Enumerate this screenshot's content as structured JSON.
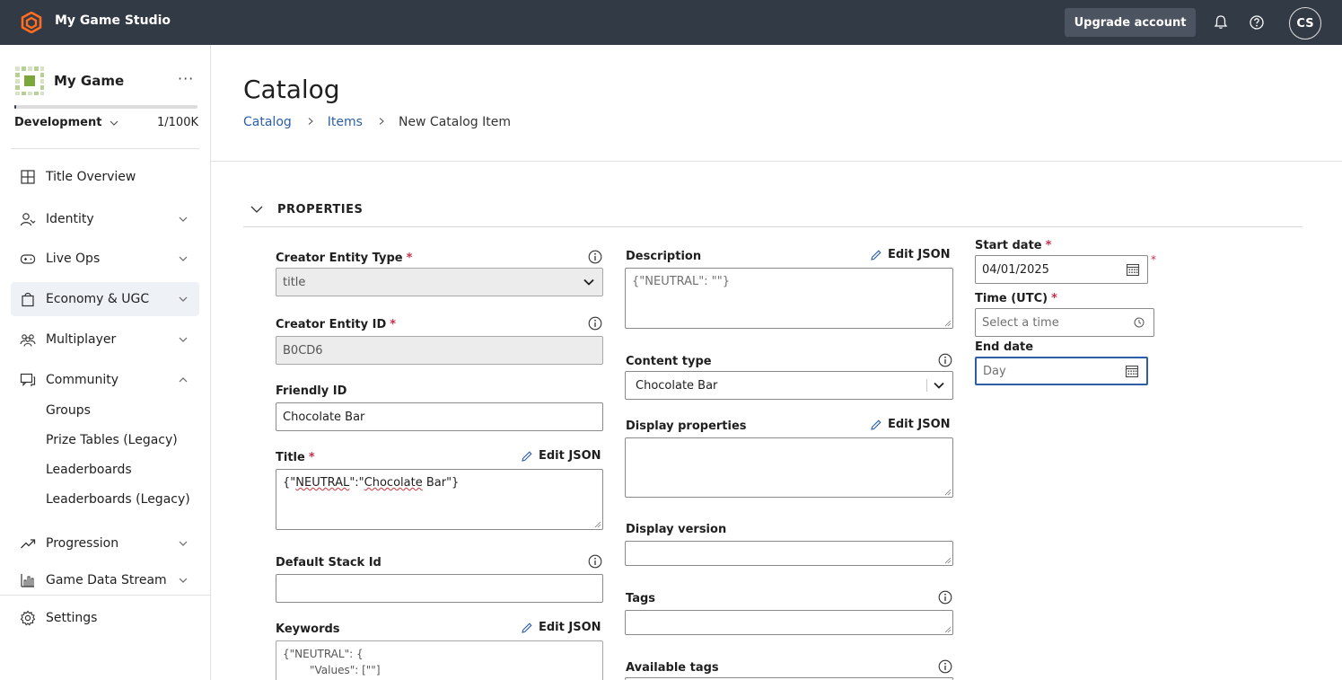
{
  "topbar": {
    "studio_name": "My Game Studio",
    "upgrade_label": "Upgrade account",
    "avatar_initials": "CS"
  },
  "sidebar": {
    "game_name": "My Game",
    "more": "···",
    "environment": "Development",
    "quota": "1/100K",
    "quota_fraction": 0.01,
    "items": [
      {
        "label": "Title Overview",
        "icon": "grid-icon"
      },
      {
        "label": "Identity",
        "icon": "identity-icon"
      },
      {
        "label": "Live Ops",
        "icon": "gamepad-icon"
      },
      {
        "label": "Economy & UGC",
        "icon": "shopping-bag-icon"
      },
      {
        "label": "Multiplayer",
        "icon": "people-icon"
      },
      {
        "label": "Community",
        "icon": "chat-icon"
      },
      {
        "label": "Progression",
        "icon": "trend-icon"
      },
      {
        "label": "Game Data Stream",
        "icon": "bar-chart-icon"
      }
    ],
    "community_sub": [
      "Groups",
      "Prize Tables (Legacy)",
      "Leaderboards",
      "Leaderboards (Legacy)"
    ],
    "settings_label": "Settings"
  },
  "page": {
    "title": "Catalog",
    "breadcrumb": [
      "Catalog",
      "Items",
      "New Catalog Item"
    ],
    "section_title": "PROPERTIES"
  },
  "form": {
    "edit_json": "Edit JSON",
    "creator_entity_type": {
      "label": "Creator Entity Type",
      "value": "title"
    },
    "creator_entity_id": {
      "label": "Creator Entity ID",
      "value": "B0CD6"
    },
    "friendly_id": {
      "label": "Friendly ID",
      "value": "Chocolate Bar"
    },
    "title": {
      "label": "Title",
      "value_a": "{\"",
      "value_b": "NEUTRAL",
      "value_c": "\":\"",
      "value_d": "Chocolate",
      "value_e": " Bar\"}"
    },
    "default_stack_id": {
      "label": "Default Stack Id",
      "value": ""
    },
    "keywords": {
      "label": "Keywords",
      "line1": "{\"NEUTRAL\": {",
      "line2": "\"Values\": [\"\"]"
    },
    "description": {
      "label": "Description",
      "value": "{\"NEUTRAL\": \"\"}"
    },
    "content_type": {
      "label": "Content type",
      "value": "Chocolate Bar"
    },
    "display_properties": {
      "label": "Display properties",
      "value": ""
    },
    "display_version": {
      "label": "Display version",
      "value": ""
    },
    "tags": {
      "label": "Tags",
      "value": ""
    },
    "available_tags": {
      "label": "Available tags"
    },
    "start_date": {
      "label": "Start date",
      "value": "04/01/2025"
    },
    "time_utc": {
      "label": "Time (UTC)",
      "placeholder": "Select a time"
    },
    "end_date": {
      "label": "End date",
      "placeholder": "Day"
    }
  },
  "colors": {
    "topbar": "#323a45",
    "accent": "#2b5fa6",
    "required": "#c4314b",
    "logo": "#ff6d21",
    "game_icon_green": "#7aa63a"
  }
}
